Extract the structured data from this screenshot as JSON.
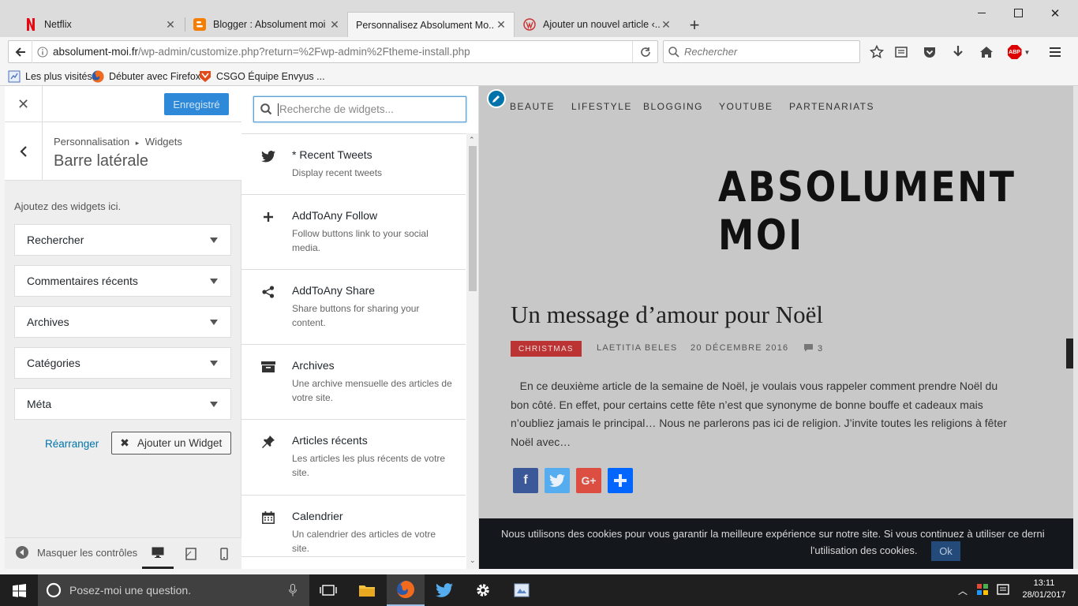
{
  "browser": {
    "tabs": [
      {
        "title": "Netflix"
      },
      {
        "title": "Blogger : Absolument moi -"
      },
      {
        "title": "Personnalisez Absolument Mo..."
      },
      {
        "title": "Ajouter un nouvel article ‹..."
      }
    ],
    "url_host": "absolument-moi.fr",
    "url_path": "/wp-admin/customize.php?return=%2Fwp-admin%2Ftheme-install.php",
    "search_placeholder": "Rechercher",
    "adblock_label": "ABP",
    "bookmarks": [
      {
        "label": "Les plus visités"
      },
      {
        "label": "Débuter avec Firefox"
      },
      {
        "label": "CSGO Équipe Envyus ..."
      }
    ]
  },
  "customizer": {
    "save_label": "Enregistré",
    "breadcrumb_parent": "Personnalisation",
    "breadcrumb_current": "Widgets",
    "section_title": "Barre latérale",
    "description": "Ajoutez des widgets ici.",
    "widgets": [
      {
        "label": "Rechercher"
      },
      {
        "label": "Commentaires récents"
      },
      {
        "label": "Archives"
      },
      {
        "label": "Catégories"
      },
      {
        "label": "Méta"
      }
    ],
    "reorder_label": "Réarranger",
    "add_widget_label": "Ajouter un Widget",
    "hide_controls_label": "Masquer les contrôles"
  },
  "widget_panel": {
    "search_placeholder": "Recherche de widgets...",
    "items": [
      {
        "title": "* Recent Tweets",
        "desc": "Display recent tweets",
        "icon": "twitter-icon"
      },
      {
        "title": "AddToAny Follow",
        "desc": "Follow buttons link to your social media.",
        "icon": "plus-icon"
      },
      {
        "title": "AddToAny Share",
        "desc": "Share buttons for sharing your content.",
        "icon": "share-icon"
      },
      {
        "title": "Archives",
        "desc": "Une archive mensuelle des articles de votre site.",
        "icon": "archive-icon"
      },
      {
        "title": "Articles récents",
        "desc": "Les articles les plus récents de votre site.",
        "icon": "pin-icon"
      },
      {
        "title": "Calendrier",
        "desc": "Un calendrier des articles de votre site.",
        "icon": "calendar-icon"
      }
    ]
  },
  "preview": {
    "nav": [
      "BEAUTE",
      "LIFESTYLE",
      "BLOGGING",
      "YOUTUBE",
      "PARTENARIATS"
    ],
    "site_title": "ABSOLUMENT MOI",
    "post_title": "Un message d’amour pour Noël",
    "category": "CHRISTMAS",
    "author": "LAETITIA BELES",
    "date": "20 DÉCEMBRE 2016",
    "comments": "3",
    "excerpt": "En ce deuxième article de la semaine de Noël, je voulais vous rappeler comment prendre Noël du bon côté. En effet, pour certains cette fête n’est que synonyme de bonne bouffe et cadeaux mais n’oubliez jamais le principal…      Nous ne parlerons pas ici de religion. J’invite toutes les religions à fêter Noël avec…",
    "cookie_line1": "Nous utilisons des cookies pour vous garantir la meilleure expérience sur notre site. Si vous continuez à utiliser ce derni",
    "cookie_line2": "l'utilisation des cookies.",
    "cookie_ok": "Ok",
    "colors": {
      "accent": "#b33333",
      "facebook": "#3b5998",
      "twitter": "#55acee",
      "google": "#dc4e41",
      "addtoany": "#0166ff"
    }
  },
  "taskbar": {
    "cortana_placeholder": "Posez-moi une question.",
    "time": "13:11",
    "date": "28/01/2017"
  }
}
